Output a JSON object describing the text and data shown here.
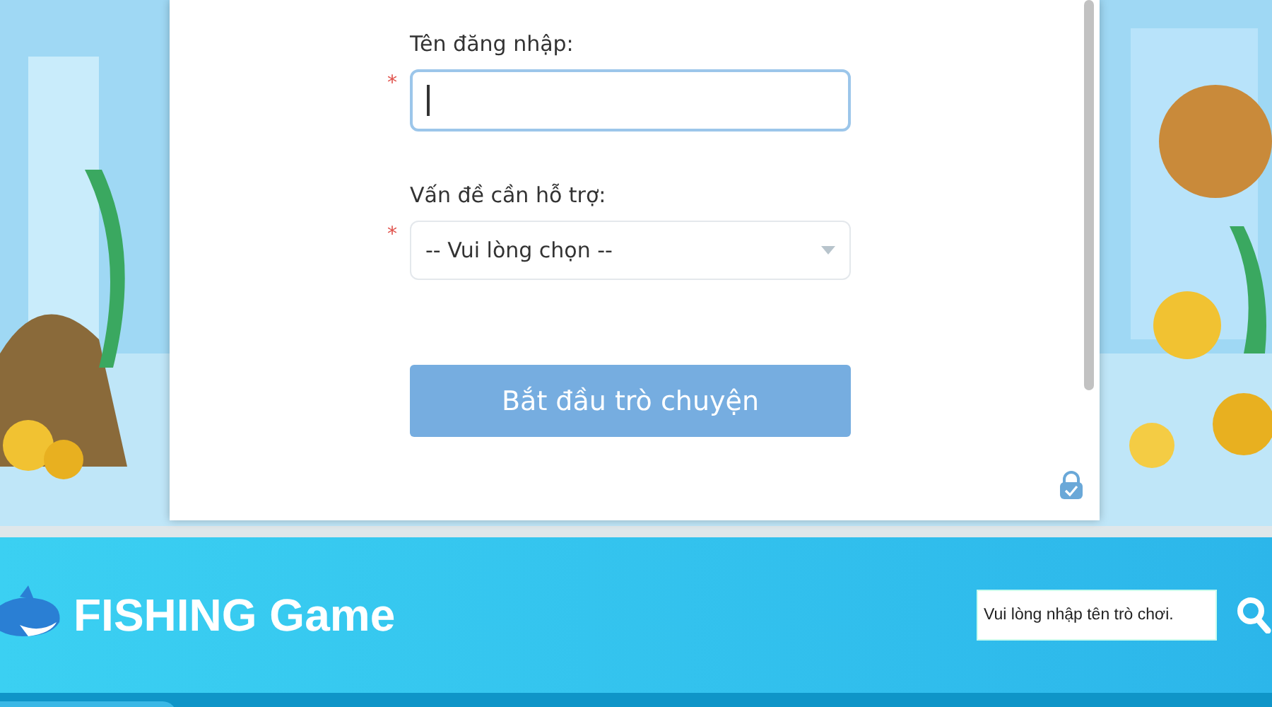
{
  "chat_form": {
    "fields": [
      {
        "kind": "text",
        "label": "Tên đăng nhập:",
        "marker": "*",
        "focused": true
      },
      {
        "kind": "select",
        "label": "Vấn đề cần hỗ trợ:",
        "marker": "*",
        "value": "-- Vui lòng chọn --"
      }
    ],
    "submit": "Bắt đầu trò chuyện"
  },
  "header": {
    "title": "FISHING Game",
    "search": {
      "placeholder": "Vui lòng nhập tên trò chơi."
    }
  }
}
